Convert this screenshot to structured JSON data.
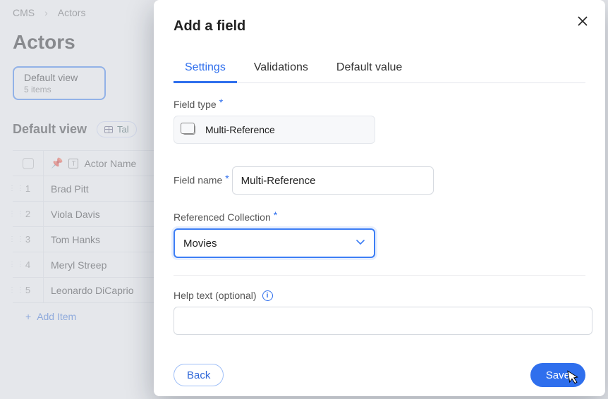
{
  "breadcrumbs": [
    "CMS",
    "Actors"
  ],
  "page_title": "Actors",
  "view": {
    "name": "Default view",
    "count_label": "5 items",
    "layout": "Tal"
  },
  "table": {
    "columns": [
      "Actor Name"
    ],
    "rows": [
      {
        "n": "1",
        "name": "Brad Pitt"
      },
      {
        "n": "2",
        "name": "Viola Davis"
      },
      {
        "n": "3",
        "name": "Tom Hanks"
      },
      {
        "n": "4",
        "name": "Meryl Streep"
      },
      {
        "n": "5",
        "name": "Leonardo DiCaprio"
      }
    ],
    "add_label": "Add Item"
  },
  "modal": {
    "title": "Add a field",
    "tabs": [
      "Settings",
      "Validations",
      "Default value"
    ],
    "form": {
      "field_type_label": "Field type",
      "field_type_value": "Multi-Reference",
      "field_name_label": "Field name",
      "field_name_value": "Multi-Reference",
      "referenced_collection_label": "Referenced Collection",
      "referenced_collection_value": "Movies",
      "help_text_label": "Help text (optional)",
      "help_text_value": ""
    },
    "actions": {
      "back": "Back",
      "save": "Save"
    }
  }
}
